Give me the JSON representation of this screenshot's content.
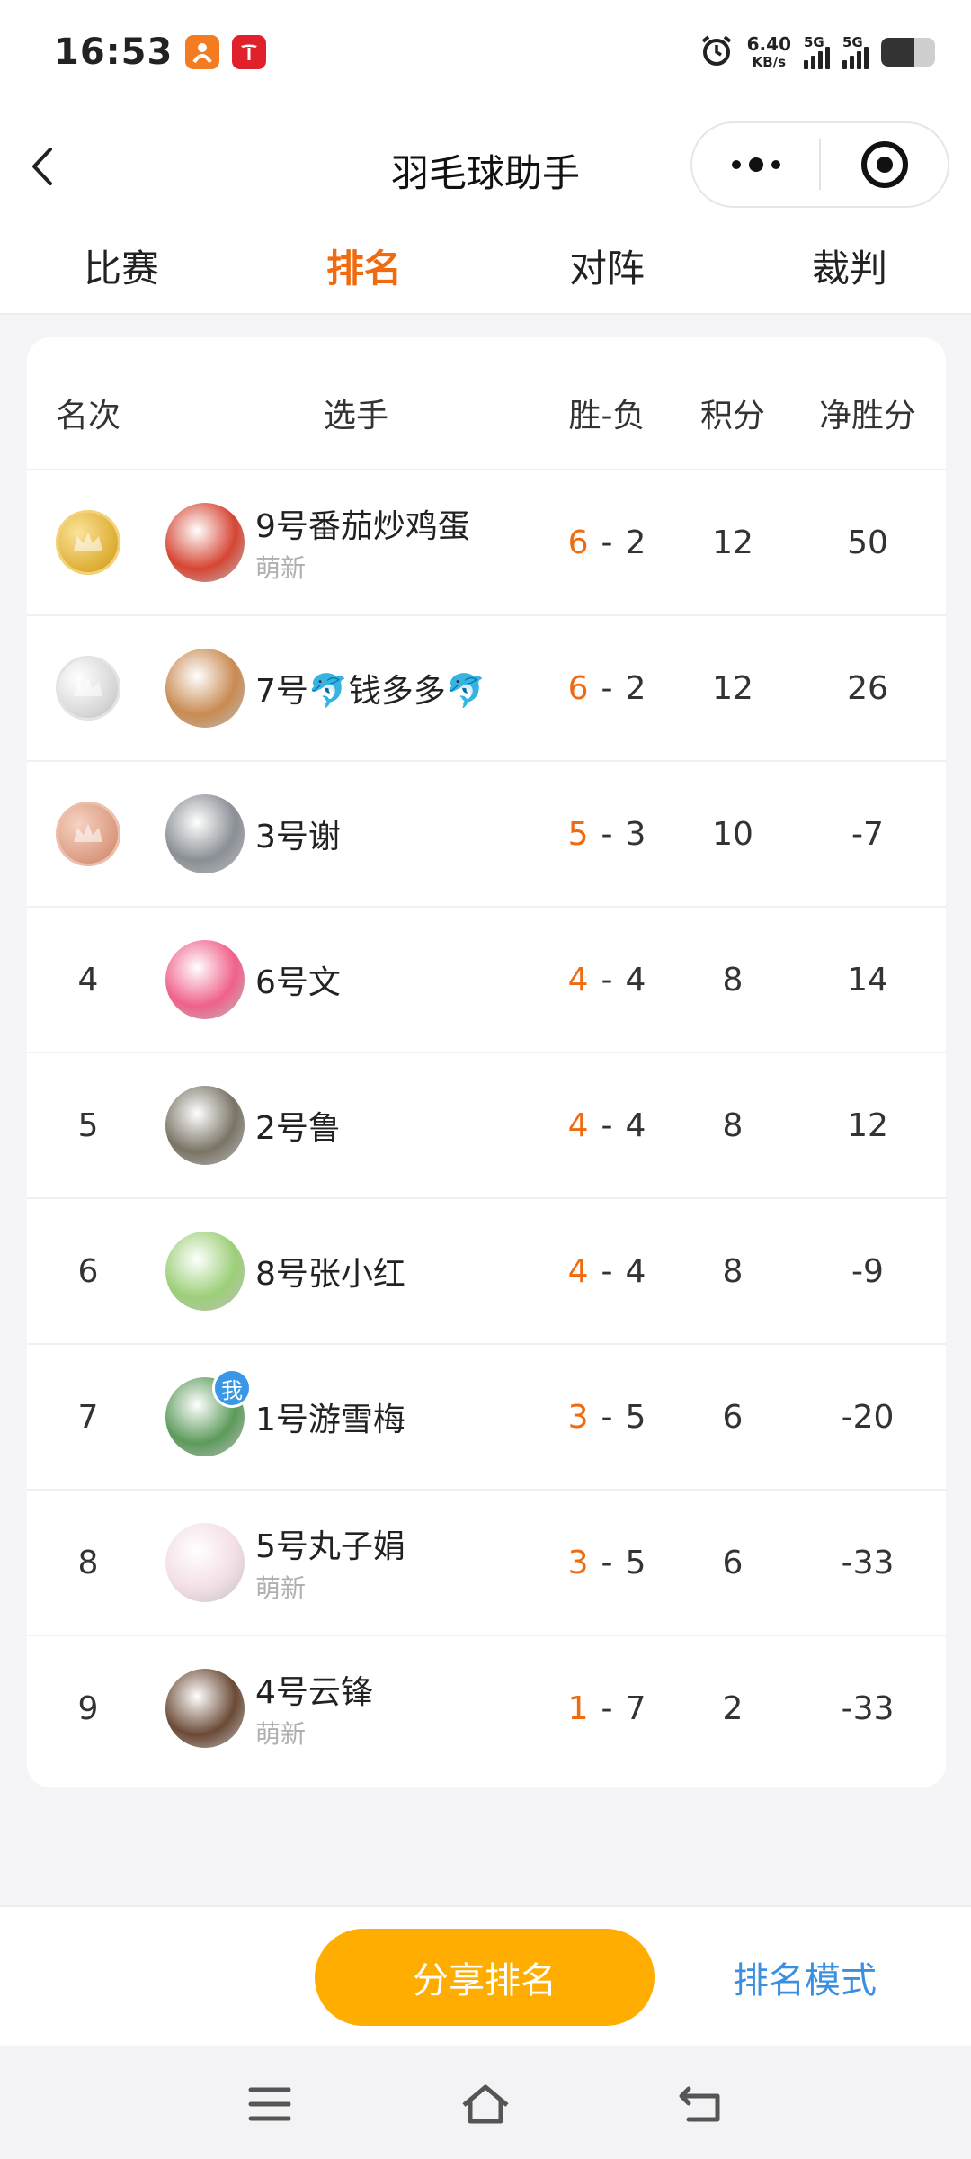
{
  "status_bar": {
    "time": "16:53",
    "net_speed_value": "6.40",
    "net_speed_unit": "KB/s",
    "signal1_label": "5G",
    "signal2_label": "5G",
    "battery_level": 0.62
  },
  "nav": {
    "title": "羽毛球助手"
  },
  "tabs": [
    {
      "label": "比赛",
      "active": false
    },
    {
      "label": "排名",
      "active": true
    },
    {
      "label": "对阵",
      "active": false
    },
    {
      "label": "裁判",
      "active": false
    }
  ],
  "table": {
    "headers": {
      "rank": "名次",
      "player": "选手",
      "win_loss": "胜-负",
      "points": "积分",
      "net": "净胜分"
    },
    "rows": [
      {
        "rank": "1",
        "medal": "gold",
        "name": "9号番茄炒鸡蛋",
        "tag": "萌新",
        "wins": "6",
        "losses": "2",
        "points": "12",
        "net": "50",
        "avatar_color": "#d64533"
      },
      {
        "rank": "2",
        "medal": "silver",
        "name": "7号🐬钱多多🐬",
        "tag": "",
        "wins": "6",
        "losses": "2",
        "points": "12",
        "net": "26",
        "avatar_color": "#c98a52"
      },
      {
        "rank": "3",
        "medal": "bronze",
        "name": "3号谢",
        "tag": "",
        "wins": "5",
        "losses": "3",
        "points": "10",
        "net": "-7",
        "avatar_color": "#8a8f95"
      },
      {
        "rank": "4",
        "medal": "",
        "name": "6号文",
        "tag": "",
        "wins": "4",
        "losses": "4",
        "points": "8",
        "net": "14",
        "avatar_color": "#f0608a"
      },
      {
        "rank": "5",
        "medal": "",
        "name": "2号鲁",
        "tag": "",
        "wins": "4",
        "losses": "4",
        "points": "8",
        "net": "12",
        "avatar_color": "#7a7466"
      },
      {
        "rank": "6",
        "medal": "",
        "name": "8号张小红",
        "tag": "",
        "wins": "4",
        "losses": "4",
        "points": "8",
        "net": "-9",
        "avatar_color": "#9ccf78"
      },
      {
        "rank": "7",
        "medal": "",
        "name": "1号游雪梅",
        "tag": "",
        "wins": "3",
        "losses": "5",
        "points": "6",
        "net": "-20",
        "avatar_color": "#5c9a5a",
        "me_badge": "我"
      },
      {
        "rank": "8",
        "medal": "",
        "name": "5号丸子娟",
        "tag": "萌新",
        "wins": "3",
        "losses": "5",
        "points": "6",
        "net": "-33",
        "avatar_color": "#f3dfe6"
      },
      {
        "rank": "9",
        "medal": "",
        "name": "4号云锋",
        "tag": "萌新",
        "wins": "1",
        "losses": "7",
        "points": "2",
        "net": "-33",
        "avatar_color": "#6b4a36"
      }
    ]
  },
  "actions": {
    "share_label": "分享排名",
    "mode_label": "排名模式"
  },
  "colors": {
    "accent_orange": "#f06a0f",
    "button_yellow": "#ffad00",
    "link_blue": "#3a8fe0"
  }
}
